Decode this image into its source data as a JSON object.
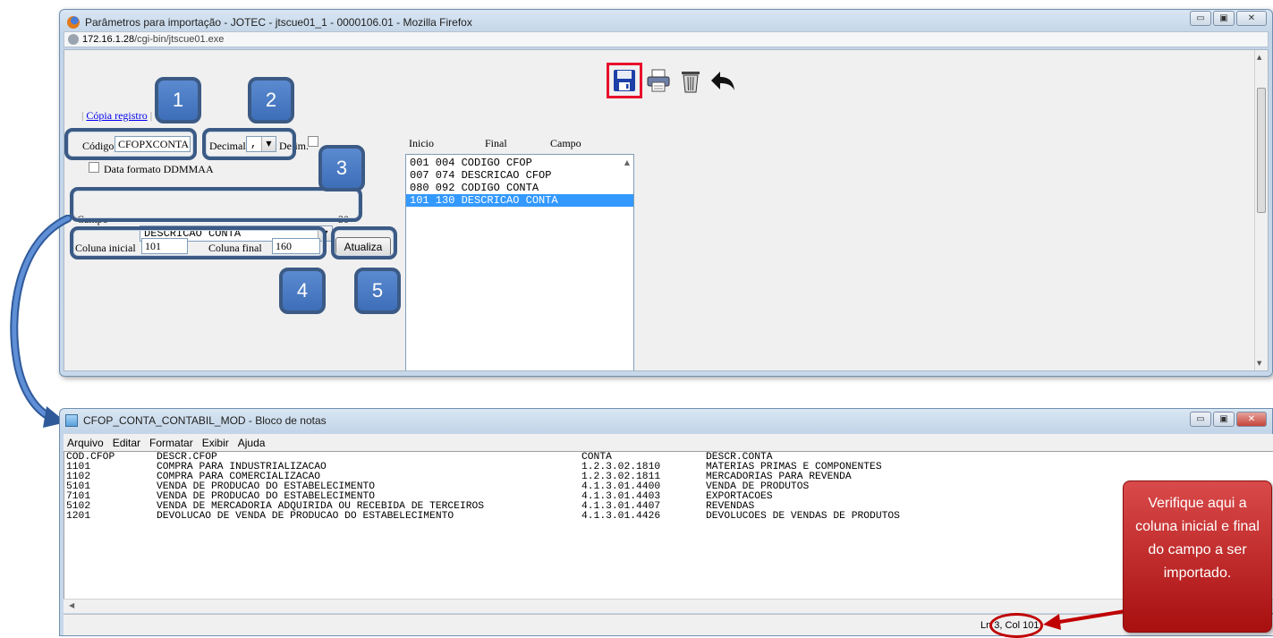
{
  "firefox": {
    "title": "Parâmetros para importação - JOTEC - jtscue01_1 - 0000106.01 - Mozilla Firefox",
    "url_host": "172.16.1.28",
    "url_path": "/cgi-bin/jtscue01.exe",
    "window_controls": [
      "▭",
      "▣",
      "✕"
    ]
  },
  "toolbar": {
    "icons": [
      "save-icon",
      "print-icon",
      "trash-icon",
      "back-arrow-icon"
    ]
  },
  "form": {
    "copy_link": "Cópia registro",
    "codigo_label": "Código",
    "codigo_value": "CFOPXCONTA",
    "decimal_label": "Decimal",
    "decimal_value": ",",
    "delim_label": "Delim.",
    "date_format_label": "Data formato DDMMAA",
    "campo_label": "Campo",
    "campo_value": "DESCRICAO CONTA",
    "campo_size": "30",
    "col_inicial_label": "Coluna inicial",
    "col_inicial_value": "101",
    "col_final_label": "Coluna final",
    "col_final_value": "160",
    "atualiza_label": "Atualiza"
  },
  "list": {
    "headers": [
      "Inicio",
      "Final",
      "Campo"
    ],
    "rows": [
      "001 004 CODIGO CFOP",
      "007 074 DESCRICAO CFOP",
      "080 092 CODIGO CONTA",
      "101 130 DESCRICAO CONTA"
    ],
    "selected_index": 3
  },
  "badges": [
    "1",
    "2",
    "3",
    "4",
    "5"
  ],
  "notepad": {
    "title": "CFOP_CONTA_CONTABIL_MOD - Bloco de notas",
    "menu": [
      "Arquivo",
      "Editar",
      "Formatar",
      "Exibir",
      "Ajuda"
    ],
    "rows": [
      [
        "COD.CFOP",
        "DESCR.CFOP",
        "CONTA",
        "DESCR.CONTA"
      ],
      [
        "1101",
        "COMPRA PARA INDUSTRIALIZACAO",
        "1.2.3.02.1810",
        "MATERIAS PRIMAS E COMPONENTES"
      ],
      [
        "1102",
        "COMPRA PARA COMERCIALIZACAO",
        "1.2.3.02.1811",
        "MERCADORIAS PARA REVENDA"
      ],
      [
        "5101",
        "VENDA DE PRODUCAO DO ESTABELECIMENTO",
        "4.1.3.01.4400",
        "VENDA DE PRODUTOS"
      ],
      [
        "7101",
        "VENDA DE PRODUCAO DO ESTABELECIMENTO",
        "4.1.3.01.4403",
        "EXPORTACOES"
      ],
      [
        "5102",
        "VENDA DE MERCADORIA ADQUIRIDA OU RECEBIDA DE TERCEIROS",
        "4.1.3.01.4407",
        "REVENDAS"
      ],
      [
        "1201",
        "DEVOLUCAO DE VENDA DE PRODUCAO DO ESTABELECIMENTO",
        "4.1.3.01.4426",
        "DEVOLUCOES DE VENDAS DE PRODUTOS"
      ]
    ],
    "status": "Ln 3, Col 101"
  },
  "callout": {
    "text": "Verifique aqui a coluna inicial e final do campo a ser importado."
  },
  "colors": {
    "highlight_blue": "#3b5a85",
    "badge_blue": "#4a7cc4",
    "save_highlight": "#e8102c",
    "callout_red": "#b71c1c",
    "selection": "#3399ff"
  }
}
